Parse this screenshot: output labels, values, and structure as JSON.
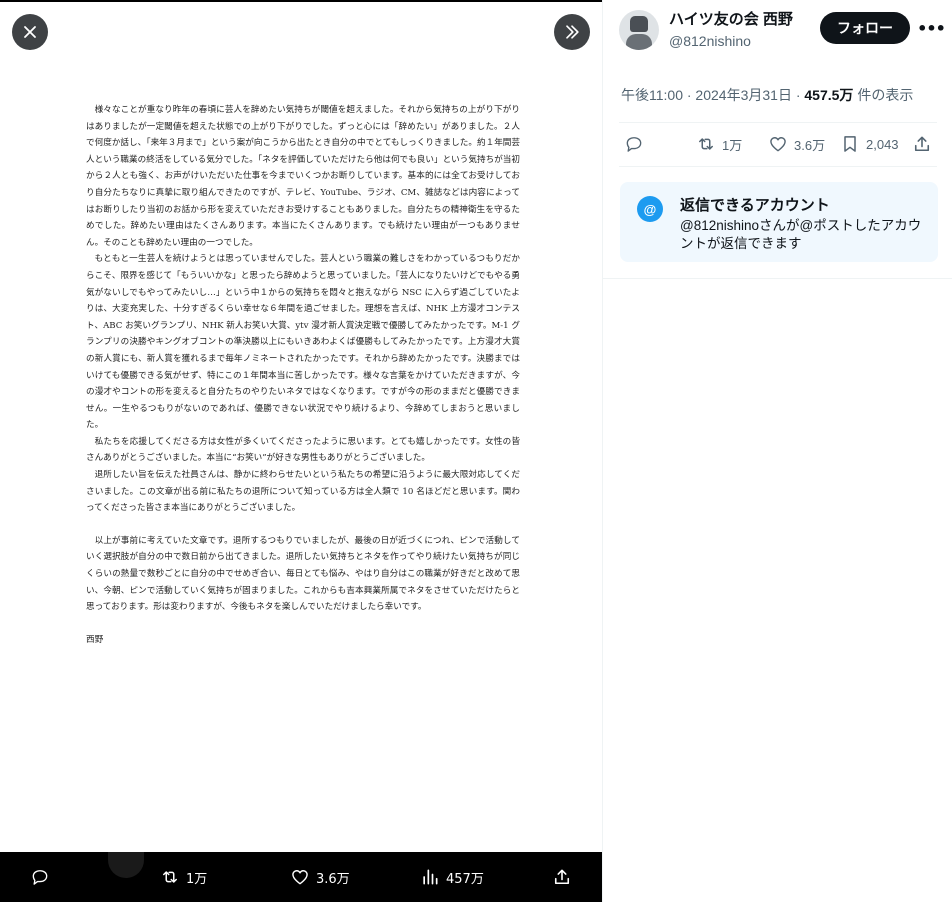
{
  "viewer": {
    "document": {
      "paragraphs": [
        "様々なことが重なり昨年の春頃に芸人を辞めたい気持ちが閾値を超えました。それから気持ちの上がり下がりはありましたが一定閾値を超えた状態での上がり下がりでした。ずっと心には「辞めたい」がありました。２人で何度か話し、「来年３月まで」という案が向こうから出たとき自分の中でとてもしっくりきました。約１年間芸人という職業の終活をしている気分でした。「ネタを評価していただけたら他は何でも良い」という気持ちが当初から２人とも強く、お声がけいただいた仕事を今までいくつかお断りしています。基本的には全てお受けしており自分たちなりに真摯に取り組んできたのですが、テレビ、YouTube、ラジオ、CM、雑誌などは内容によってはお断りしたり当初のお話から形を変えていただきお受けすることもありました。自分たちの精神衛生を守るためでした。辞めたい理由はたくさんあります。本当にたくさんあります。でも続けたい理由が一つもありません。そのことも辞めたい理由の一つでした。",
        "もともと一生芸人を続けようとは思っていませんでした。芸人という職業の難しさをわかっているつもりだからこそ、限界を感じて「もういいかな」と思ったら辞めようと思っていました。「芸人になりたいけどでもやる勇気がないしでもやってみたいし…」という中１からの気持ちを悶々と抱えながら NSC に入らず過ごしていたよりは、大変充実した、十分すぎるくらい幸せな６年間を過ごせました。理想を言えば、NHK 上方漫才コンテスト、ABC お笑いグランプリ、NHK 新人お笑い大賞、ytv 漫才新人賞決定戦で優勝してみたかったです。M-1 グランプリの決勝やキングオブコントの準決勝以上にもいきあわよくば優勝もしてみたかったです。上方漫才大賞の新人賞にも、新人賞を獲れるまで毎年ノミネートされたかったです。それから辞めたかったです。決勝まではいけても優勝できる気がせず、特にこの１年間本当に苦しかったです。様々な言葉をかけていただきますが、今の漫才やコントの形を変えると自分たちのやりたいネタではなくなります。ですが今の形のままだと優勝できません。一生やるつもりがないのであれば、優勝できない状況でやり続けるより、今辞めてしまおうと思いました。",
        "私たちを応援してくださる方は女性が多くいてくださったように思います。とても嬉しかったです。女性の皆さんありがとうございました。本当に“お笑い”が好きな男性もありがとうございました。",
        "退所したい旨を伝えた社員さんは、静かに終わらせたいという私たちの希望に沿うように最大限対応してくださいました。この文章が出る前に私たちの退所について知っている方は全人類で 10 名ほどだと思います。関わってくださった皆さま本当にありがとうございました。",
        "以上が事前に考えていた文章です。退所するつもりでいましたが、最後の日が近づくにつれ、ピンで活動していく選択肢が自分の中で数日前から出てきました。退所したい気持ちとネタを作ってやり続けたい気持ちが同じくらいの熱量で数秒ごとに自分の中でせめぎ合い、毎日とても悩み、やはり自分はこの職業が好きだと改めて思い、今朝、ピンで活動していく気持ちが固まりました。これからも吉本興業所属でネタをさせていただけたらと思っております。形は変わりますが、今後もネタを楽しんでいただけましたら幸いです。"
      ],
      "signature": "西野"
    },
    "bottom_bar": {
      "retweets": "1万",
      "likes": "3.6万",
      "views": "457万"
    }
  },
  "sidebar": {
    "author": {
      "display_name": "ハイツ友の会 西野",
      "handle": "@812nishino"
    },
    "follow_label": "フォロー",
    "more_label": "•••",
    "meta": {
      "time": "午後11:00 · 2024年3月31日 · ",
      "views": "457.5万",
      "views_suffix": " 件の表示"
    },
    "actions": {
      "retweets": "1万",
      "likes": "3.6万",
      "bookmarks": "2,043"
    },
    "reply_notice": {
      "icon": "@",
      "title": "返信できるアカウント",
      "text": "@812nishinoさんが@ポストしたアカウントが返信できます"
    }
  }
}
